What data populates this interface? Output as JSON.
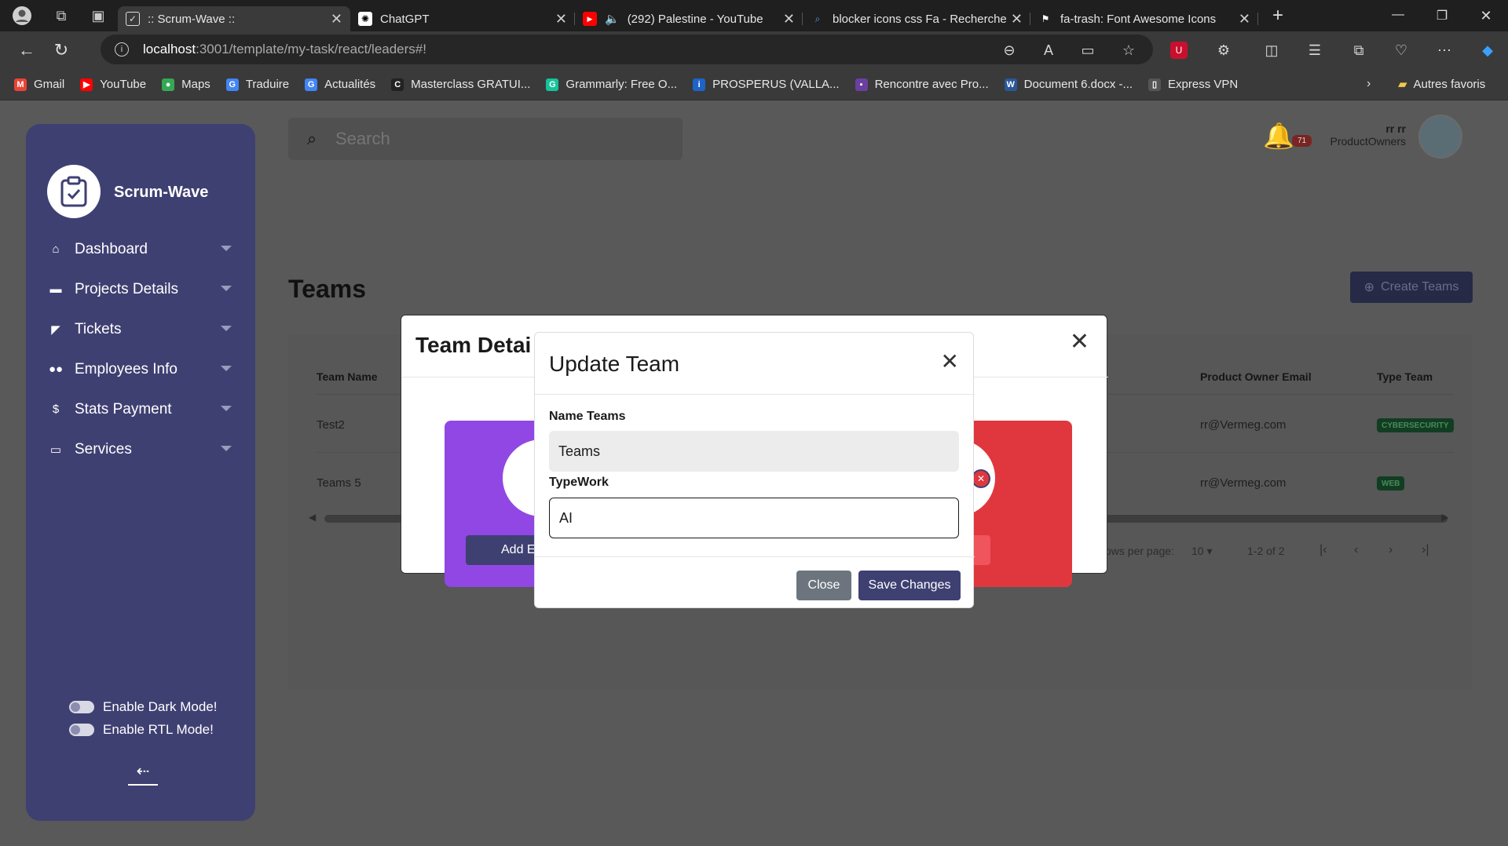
{
  "browser": {
    "tabs": [
      {
        "title": ":: Scrum-Wave ::",
        "icon": "clipboard-icon",
        "active": true
      },
      {
        "title": "ChatGPT",
        "icon": "chatgpt-icon"
      },
      {
        "title": "(292) Palestine - YouTube",
        "icon": "youtube-icon"
      },
      {
        "title": "blocker icons css Fa - Recherche",
        "icon": "search-icon"
      },
      {
        "title": "fa-trash: Font Awesome Icons",
        "icon": "flag-icon"
      }
    ],
    "url_host": "localhost",
    "url_path": ":3001/template/my-task/react/leaders#!",
    "bookmarks": [
      {
        "label": "Gmail",
        "color": "#ea4335",
        "glyph": "M"
      },
      {
        "label": "YouTube",
        "color": "#ff0000",
        "glyph": "▶"
      },
      {
        "label": "Maps",
        "color": "#34a853",
        "glyph": "●"
      },
      {
        "label": "Traduire",
        "color": "#4285f4",
        "glyph": "G"
      },
      {
        "label": "Actualités",
        "color": "#4285f4",
        "glyph": "G"
      },
      {
        "label": "Masterclass GRATUI...",
        "color": "#222222",
        "glyph": "C"
      },
      {
        "label": "Grammarly: Free O...",
        "color": "#15c39a",
        "glyph": "G"
      },
      {
        "label": "PROSPERUS (VALLA...",
        "color": "#1e63c7",
        "glyph": "i"
      },
      {
        "label": "Rencontre avec Pro...",
        "color": "#6b3fa0",
        "glyph": "▪"
      },
      {
        "label": "Document 6.docx -...",
        "color": "#2b579a",
        "glyph": "W"
      },
      {
        "label": "Express VPN",
        "color": "#555555",
        "glyph": "▯"
      }
    ],
    "other_favorites": "Autres favoris"
  },
  "sidebar": {
    "brand": "Scrum-Wave",
    "items": [
      {
        "label": "Dashboard",
        "icon": "home-icon"
      },
      {
        "label": "Projects Details",
        "icon": "briefcase-icon"
      },
      {
        "label": "Tickets",
        "icon": "ticket-icon"
      },
      {
        "label": "Employees Info",
        "icon": "users-icon"
      },
      {
        "label": "Stats Payment",
        "icon": "money-icon"
      },
      {
        "label": "Services",
        "icon": "monitor-icon"
      }
    ],
    "dark_mode_label": "Enable Dark Mode!",
    "rtl_mode_label": "Enable RTL Mode!"
  },
  "header": {
    "search_placeholder": "Search",
    "notification_count": "71",
    "user_name": "rr rr",
    "user_role": "ProductOwners"
  },
  "main": {
    "title": "Teams",
    "create_button": "Create Teams",
    "table": {
      "headers": [
        "Team Name",
        "Product Owner Email",
        "Type Team"
      ],
      "rows": [
        {
          "name": "Test2",
          "email": "rr@Vermeg.com",
          "type": "CYBERSECURITY"
        },
        {
          "name": "Teams 5",
          "email": "rr@Vermeg.com",
          "type": "WEB"
        }
      ]
    },
    "pagination": {
      "rows_label": "ows per page:",
      "rows_value": "10",
      "range": "1-2 of 2"
    }
  },
  "team_details_modal": {
    "title": "Team Detai",
    "add_button": "Add E",
    "delete_button": "eam"
  },
  "update_modal": {
    "title": "Update Team",
    "name_label": "Name Teams",
    "name_value": "Teams",
    "type_label": "TypeWork",
    "type_value": "AI",
    "close_button": "Close",
    "save_button": "Save Changes"
  },
  "colors": {
    "sidebar": "#3f4072",
    "primary_button": "#3f4072",
    "secondary_button": "#6c757d",
    "tile_purple": "#9147e4",
    "tile_red": "#e0373f"
  }
}
